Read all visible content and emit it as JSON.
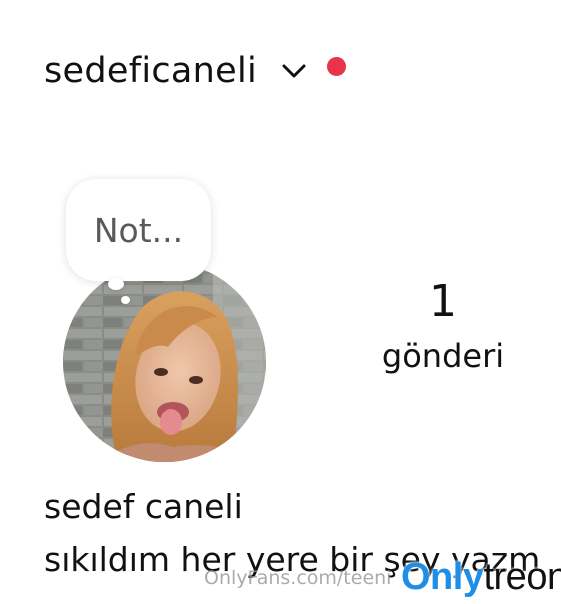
{
  "profile": {
    "username": "sedeficaneli",
    "full_name": "sedef caneli",
    "bio": "sıkıldım her yere bir şey yazm",
    "dropdown_icon": "chevron-down-icon",
    "notification_icon": "red-dot-icon"
  },
  "note": {
    "placeholder": "Not..."
  },
  "stats": {
    "posts_count": "1",
    "posts_label": "gönderi"
  },
  "watermark": {
    "url": "OnlyFans.com/teeni",
    "logo_part1": "Only",
    "logo_part2": "treon"
  },
  "colors": {
    "notification_dot": "#e8344a",
    "logo_blue": "#1f8ee8",
    "logo_dark": "#111111"
  }
}
